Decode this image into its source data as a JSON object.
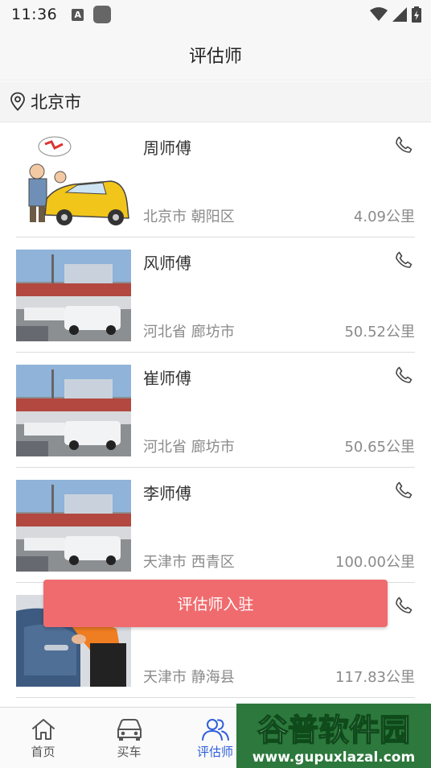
{
  "status_bar": {
    "time": "11:36",
    "a_icon_letter": "A"
  },
  "header": {
    "title": "评估师"
  },
  "location": {
    "city": "北京市"
  },
  "appraisers": [
    {
      "name": "周师傅",
      "region": "北京市 朝阳区",
      "distance": "4.09公里",
      "photo": "cartoon-car-inspection"
    },
    {
      "name": "风师傅",
      "region": "河北省 廊坊市",
      "distance": "50.52公里",
      "photo": "car-lot"
    },
    {
      "name": "崔师傅",
      "region": "河北省 廊坊市",
      "distance": "50.65公里",
      "photo": "car-lot"
    },
    {
      "name": "李师傅",
      "region": "天津市 西青区",
      "distance": "100.00公里",
      "photo": "car-lot"
    },
    {
      "name": "",
      "region": "天津市 静海县",
      "distance": "117.83公里",
      "photo": "car-door-handle"
    }
  ],
  "join_button": {
    "label": "评估师入驻"
  },
  "tabs": [
    {
      "label": "首页",
      "icon": "home-icon"
    },
    {
      "label": "买车",
      "icon": "car-icon"
    },
    {
      "label": "评估师",
      "icon": "users-icon",
      "active": true
    }
  ],
  "watermark": {
    "brand": "谷普软件园",
    "url": "www.gupuxlazal.com"
  },
  "colors": {
    "accent": "#2f5fd9",
    "join_button": "#f06b6e",
    "muted_text": "#8a8a8a"
  }
}
